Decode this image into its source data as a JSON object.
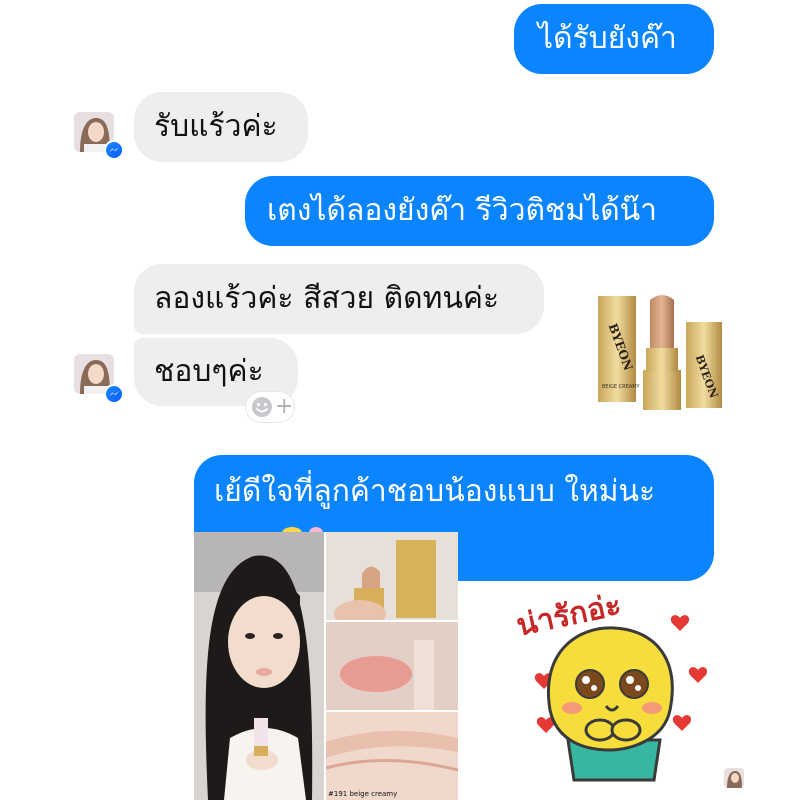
{
  "messages": [
    {
      "from": "me",
      "text": "ได้รับยังค๊า"
    },
    {
      "from": "them",
      "text": "รับแร้วค่ะ"
    },
    {
      "from": "me",
      "text": "เตงได้ลองยังค๊า รีวิวติชมได้น๊า"
    },
    {
      "from": "them",
      "text": "ลองแร้วค่ะ สีสวย ติดทนค่ะ"
    },
    {
      "from": "them",
      "text": "ชอบๆค่ะ"
    },
    {
      "from": "me",
      "text": "เย้ดีใจที่ลูกค้าชอบน้องแบบ ใหม่นะ"
    }
  ],
  "product": {
    "brand": "BYEON",
    "name": "BEIGE CREAMY"
  },
  "review_photo_caption": "#191 beige creamy",
  "sticker": {
    "text": "น่ารักอ่ะ",
    "icon": "cute-character-sticker"
  },
  "reaction_button": {
    "icon": "add-reaction-icon",
    "symbol": "+"
  },
  "colors": {
    "outgoing_bubble": "#0a84ff",
    "incoming_bubble": "#eeeeef",
    "messenger_badge": "#1e88ff",
    "sticker_text": "#c62828",
    "sticker_body": "#f7dd3b"
  }
}
